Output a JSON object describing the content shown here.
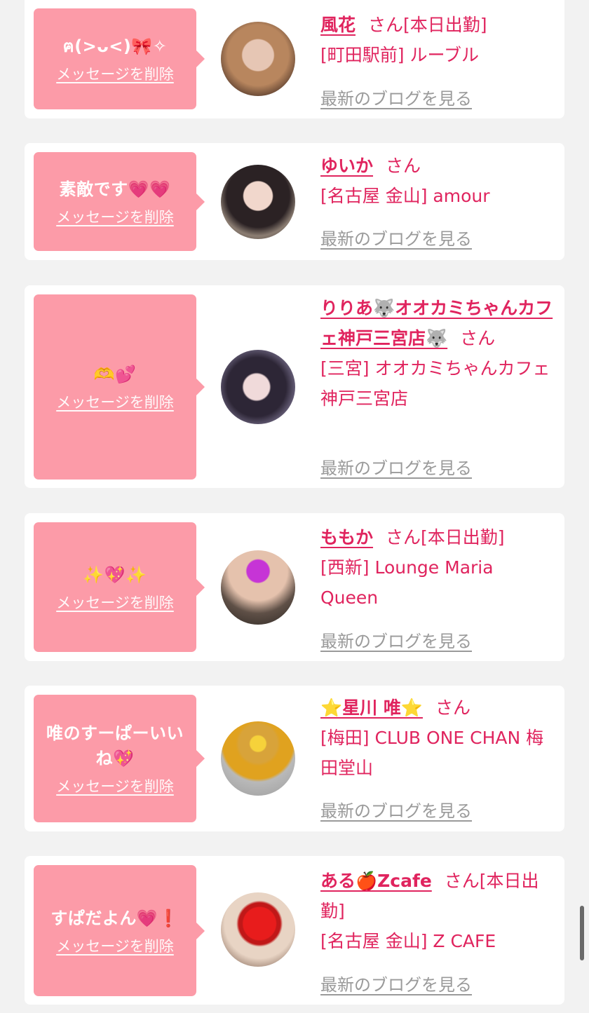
{
  "cards": [
    {
      "message": "ฅ(>ᴗ<)🎀✧",
      "delete_label": "メッセージを削除",
      "name": "風花",
      "honorific": "さん[本日出勤]",
      "shop": "[町田駅前] ルーブル",
      "blog_label": "最新のブログを見る"
    },
    {
      "message": "素敵です💗💗",
      "delete_label": "メッセージを削除",
      "name": "ゆいか",
      "honorific": "さん",
      "shop": "[名古屋 金山] amour",
      "blog_label": "最新のブログを見る"
    },
    {
      "message": "🫶💕",
      "delete_label": "メッセージを削除",
      "name": "りりあ🐺オオカミちゃんカフェ神戸三宮店🐺",
      "honorific": "さん",
      "shop": "[三宮] オオカミちゃんカフェ神戸三宮店",
      "blog_label": "最新のブログを見る"
    },
    {
      "message": "✨💖✨",
      "delete_label": "メッセージを削除",
      "name": "ももか",
      "honorific": "さん[本日出勤]",
      "shop": "[西新] Lounge Maria Queen",
      "blog_label": "最新のブログを見る"
    },
    {
      "message": "唯のすーぱーいいね💖",
      "delete_label": "メッセージを削除",
      "name": "⭐星川 唯⭐",
      "honorific": "さん",
      "shop": "[梅田] CLUB ONE CHAN 梅田堂山",
      "blog_label": "最新のブログを見る"
    },
    {
      "message": "すぱだよん💗❗",
      "delete_label": "メッセージを削除",
      "name": "ある🍎Zcafe",
      "honorific": "さん[本日出勤]",
      "shop": "[名古屋 金山] Z CAFE",
      "blog_label": "最新のブログを見る"
    }
  ]
}
